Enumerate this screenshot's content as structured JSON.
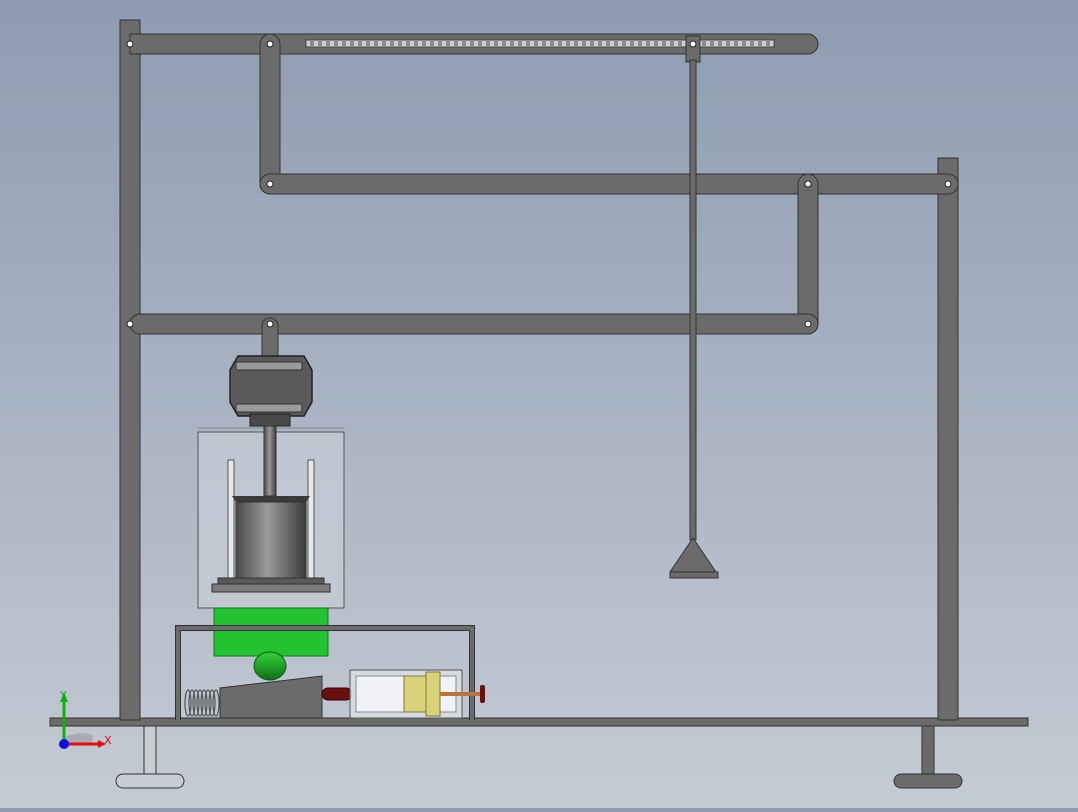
{
  "viewport": {
    "background_top": "#8d9cb0",
    "background_bottom": "#c5cbd4"
  },
  "colors": {
    "steel": "#6b6b6b",
    "steel_dark": "#3a3a3a",
    "pin": "#ffffff",
    "green_part": "#22c230",
    "green_knob": "#178a1e",
    "glass": "#c9d0d9",
    "yellow_piston": "#d8d37a",
    "dark_red": "#6a1010",
    "copper": "#b8743c"
  },
  "triad": {
    "x_label": "X",
    "y_label": "Y",
    "x_color": "#e01010",
    "y_color": "#10b010",
    "z_color": "#1010e0"
  }
}
